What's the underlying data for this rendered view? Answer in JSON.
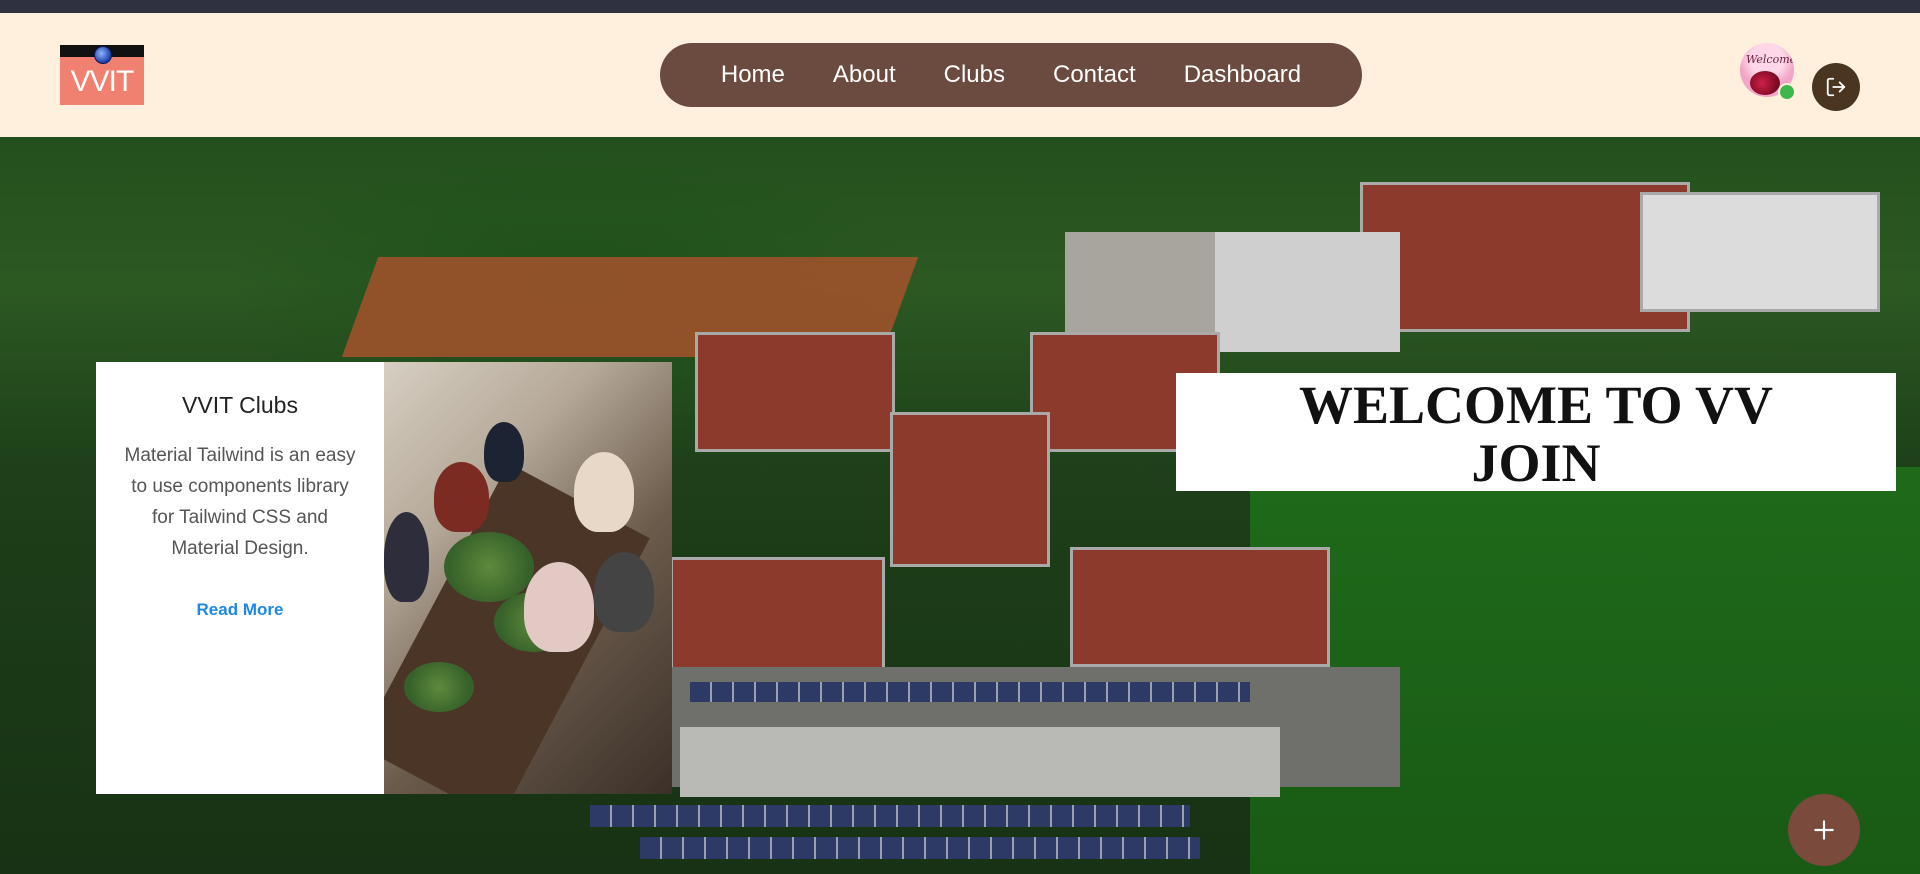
{
  "brand": {
    "logo_text": "VVIT"
  },
  "nav": {
    "items": [
      {
        "label": "Home"
      },
      {
        "label": "About"
      },
      {
        "label": "Clubs"
      },
      {
        "label": "Contact"
      },
      {
        "label": "Dashboard"
      }
    ]
  },
  "user": {
    "avatar_text": "Welcome",
    "status": "online"
  },
  "card": {
    "title": "VVIT Clubs",
    "description": "Material Tailwind is an easy to use components library for Tailwind CSS and Material Design.",
    "link_label": "Read More"
  },
  "hero": {
    "line1": "WELCOME TO VV",
    "line2": "JOIN"
  },
  "icons": {
    "logout": "logout-icon",
    "add": "plus-icon"
  },
  "colors": {
    "navbar_bg": "#fff0de",
    "nav_pill": "#6b4b40",
    "logo_bg": "#f08070",
    "link": "#1e88e5",
    "fab": "#7a4a3c",
    "online": "#3eb84d"
  }
}
